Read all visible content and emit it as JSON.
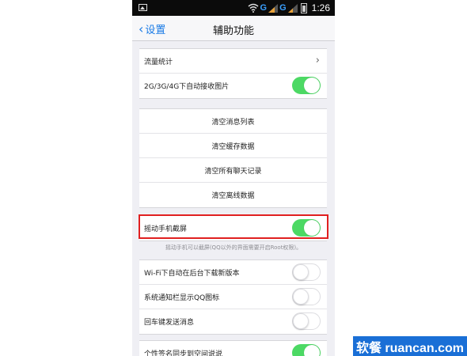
{
  "status_bar": {
    "time": "1:26",
    "network_1": "G",
    "network_2": "G"
  },
  "nav": {
    "back_label": "设置",
    "title": "辅助功能"
  },
  "group_1": [
    {
      "label": "流量统计",
      "type": "chevron"
    },
    {
      "label": "2G/3G/4G下自动接收图片",
      "type": "toggle",
      "on": true
    }
  ],
  "group_2": [
    {
      "label": "清空消息列表"
    },
    {
      "label": "清空缓存数据"
    },
    {
      "label": "清空所有聊天记录"
    },
    {
      "label": "清空离线数据"
    }
  ],
  "group_3": [
    {
      "label": "摇动手机截屏",
      "type": "toggle",
      "on": true
    }
  ],
  "hint": "摇动手机可以截屏(QQ以外的界面需要开启Root权限)。",
  "group_4": [
    {
      "label": "Wi-Fi下自动在后台下载新版本",
      "type": "toggle",
      "on": false
    },
    {
      "label": "系统通知栏显示QQ图标",
      "type": "toggle",
      "on": false
    },
    {
      "label": "回车键发送消息",
      "type": "toggle",
      "on": false
    }
  ],
  "group_5": [
    {
      "label": "个性签名同步到空间说说",
      "type": "toggle",
      "on": true
    }
  ],
  "watermark": "软餐 ruancan.com",
  "colors": {
    "accent": "#1a7be6",
    "toggle_on": "#4cd964",
    "highlight": "#e02020",
    "watermark_bg": "#1a6fd6"
  }
}
